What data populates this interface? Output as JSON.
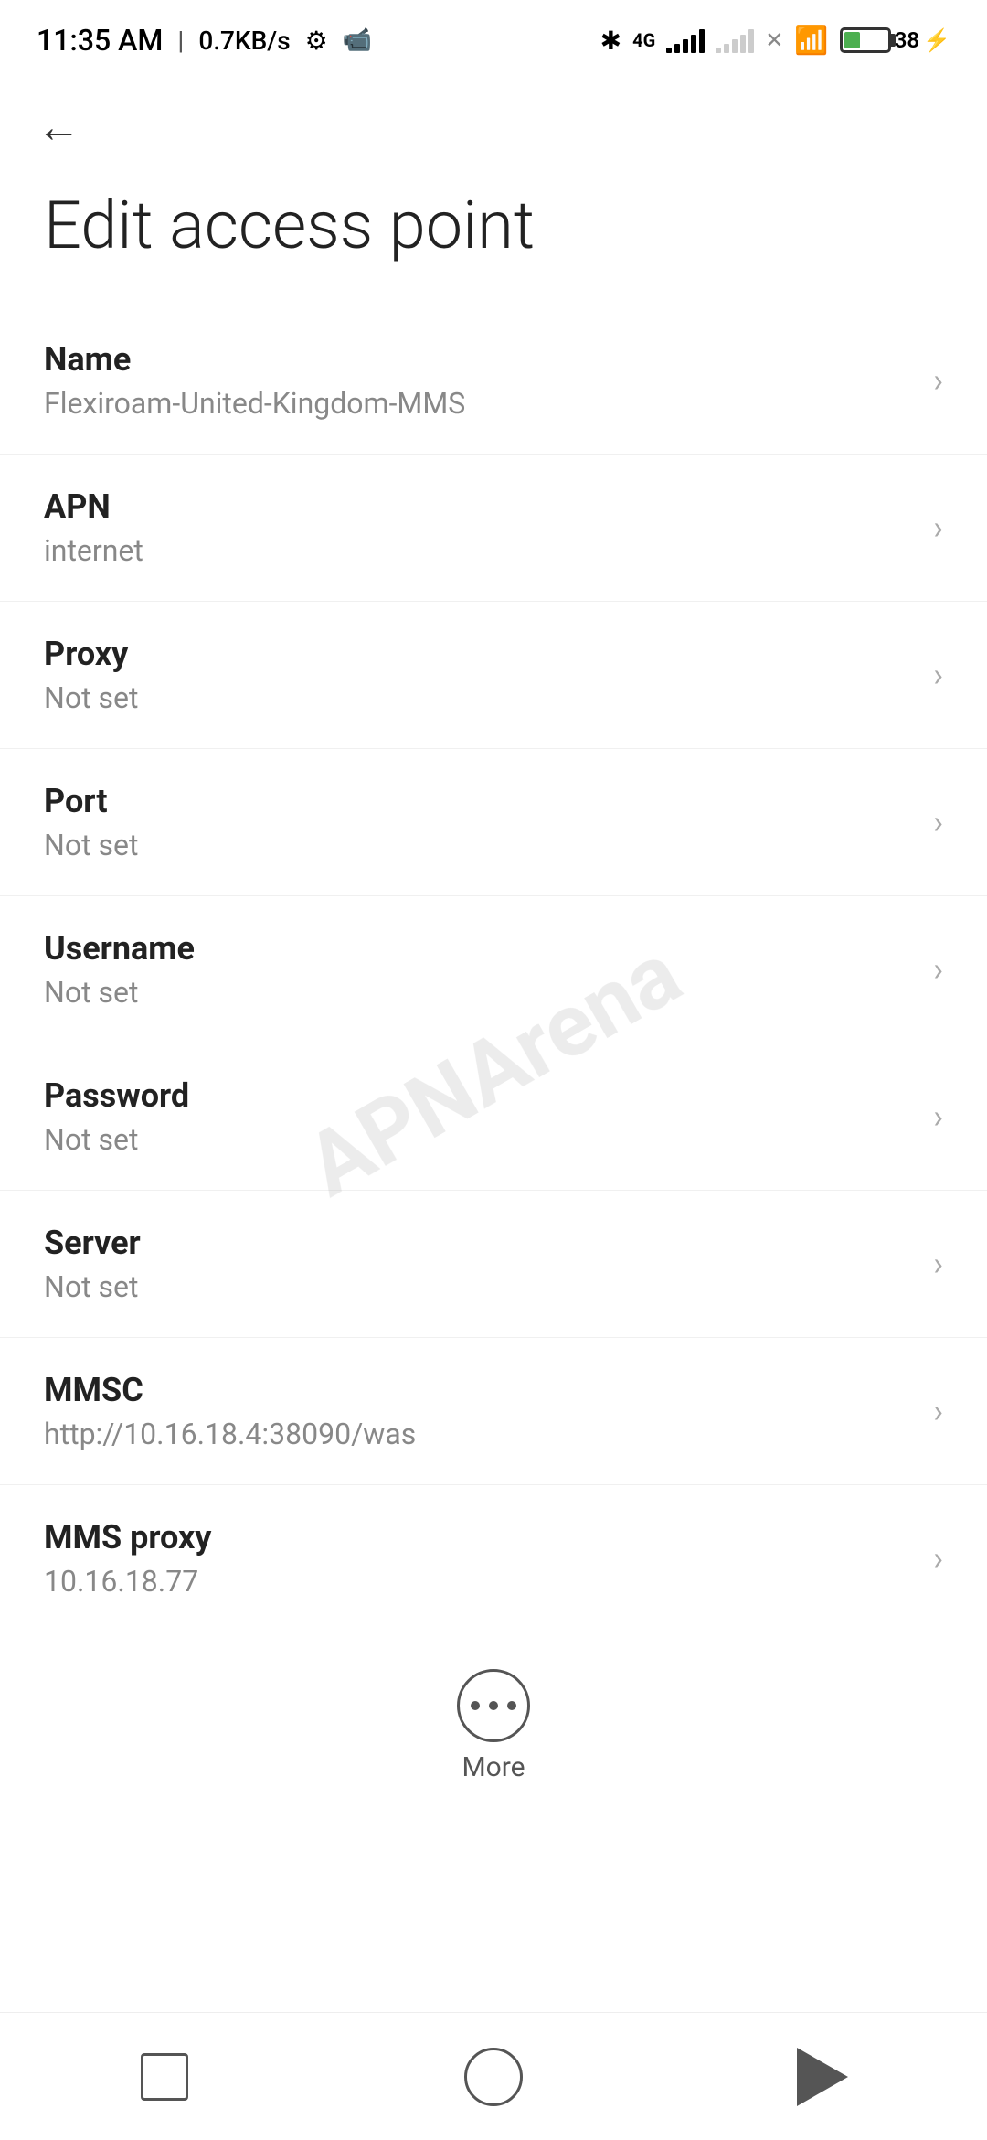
{
  "statusBar": {
    "time": "11:35 AM",
    "speed": "0.7KB/s"
  },
  "header": {
    "backLabel": "←",
    "title": "Edit access point"
  },
  "settings": {
    "items": [
      {
        "label": "Name",
        "value": "Flexiroam-United-Kingdom-MMS"
      },
      {
        "label": "APN",
        "value": "internet"
      },
      {
        "label": "Proxy",
        "value": "Not set"
      },
      {
        "label": "Port",
        "value": "Not set"
      },
      {
        "label": "Username",
        "value": "Not set"
      },
      {
        "label": "Password",
        "value": "Not set"
      },
      {
        "label": "Server",
        "value": "Not set"
      },
      {
        "label": "MMSC",
        "value": "http://10.16.18.4:38090/was"
      },
      {
        "label": "MMS proxy",
        "value": "10.16.18.77"
      }
    ]
  },
  "more": {
    "label": "More"
  },
  "watermark": {
    "text": "APNArena"
  },
  "navbar": {
    "items": [
      "square",
      "circle",
      "triangle"
    ]
  }
}
